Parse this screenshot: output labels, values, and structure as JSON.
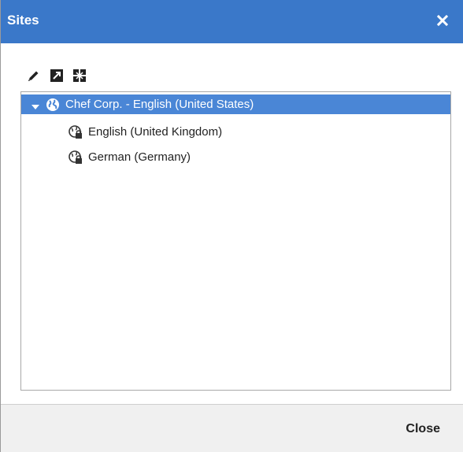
{
  "dialog": {
    "title": "Sites",
    "close_button_label": "Close"
  },
  "toolbar": {
    "icons": [
      "edit-icon",
      "expand-icon",
      "collapse-icon"
    ]
  },
  "tree": {
    "root": {
      "label": "Chef Corp. - English (United States)",
      "icon": "globe-icon",
      "expanded": true
    },
    "children": [
      {
        "label": "English (United Kingdom)",
        "icon": "locked-globe-icon"
      },
      {
        "label": "German (Germany)",
        "icon": "locked-globe-icon"
      }
    ]
  },
  "colors": {
    "titlebar": "#3a78c9",
    "selected_row": "#4a86d6"
  }
}
